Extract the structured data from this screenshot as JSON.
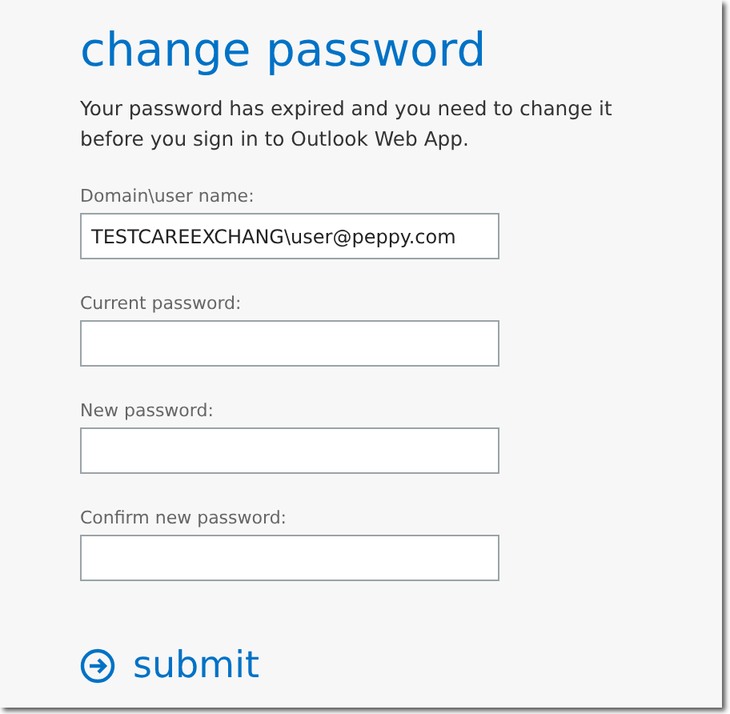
{
  "title": "change password",
  "description": "Your password has expired and you need to change it before you sign in to Outlook Web App.",
  "fields": [
    {
      "label": "Domain\\user name:",
      "value": "TESTCAREEXCHANG\\user@peppy.com"
    },
    {
      "label": "Current password:"
    },
    {
      "label": "New password:"
    },
    {
      "label": "Confirm new password:"
    }
  ],
  "submit": {
    "label": "submit"
  }
}
